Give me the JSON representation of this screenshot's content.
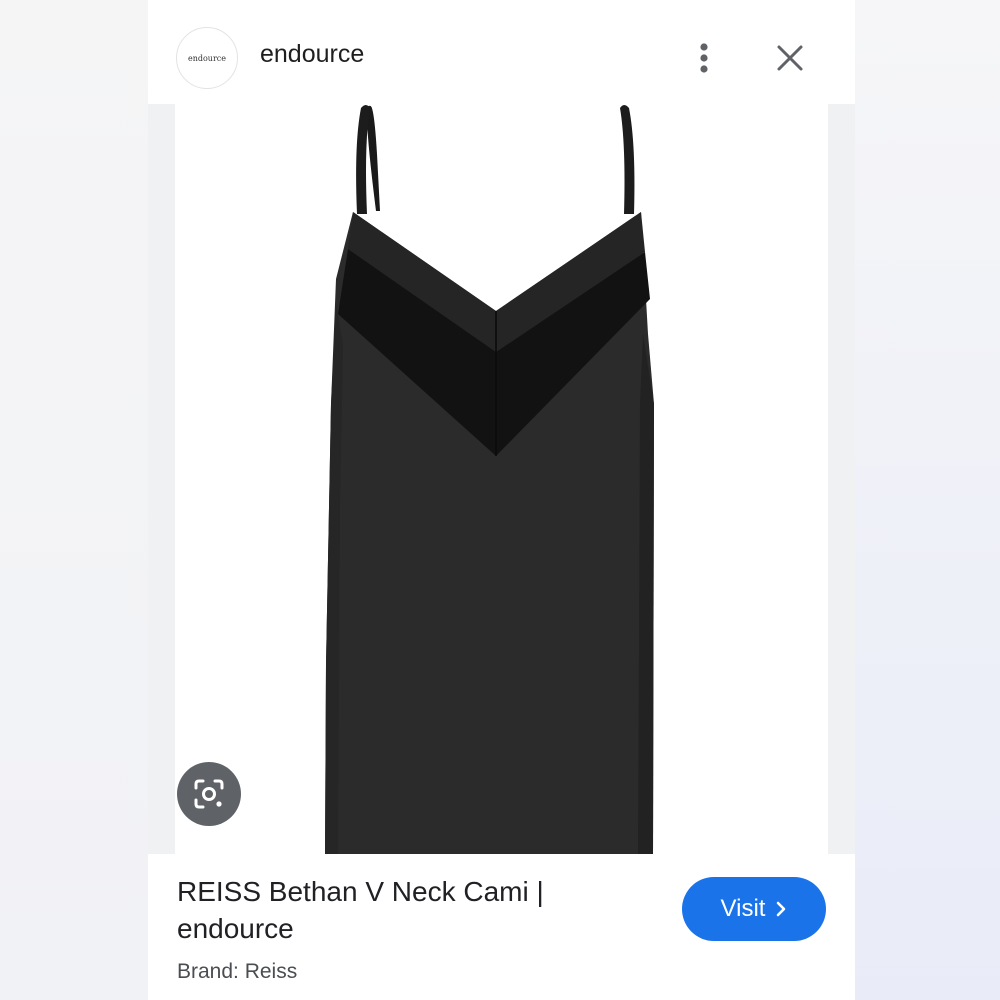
{
  "header": {
    "logo_text": "endource",
    "site_name": "endource",
    "more_icon": "more-vertical-icon",
    "close_icon": "close-icon"
  },
  "result": {
    "image_description_icon": "lens-icon",
    "title_line1": "REISS Bethan V Neck Cami |",
    "title_line2": "endource",
    "brand": "Brand: Reiss",
    "visit_label": "Visit",
    "visit_icon": "chevron-right-icon"
  },
  "colors": {
    "accent": "#1a73e8",
    "garment": "#2a2a2a",
    "lens_button": "#5f6368"
  }
}
